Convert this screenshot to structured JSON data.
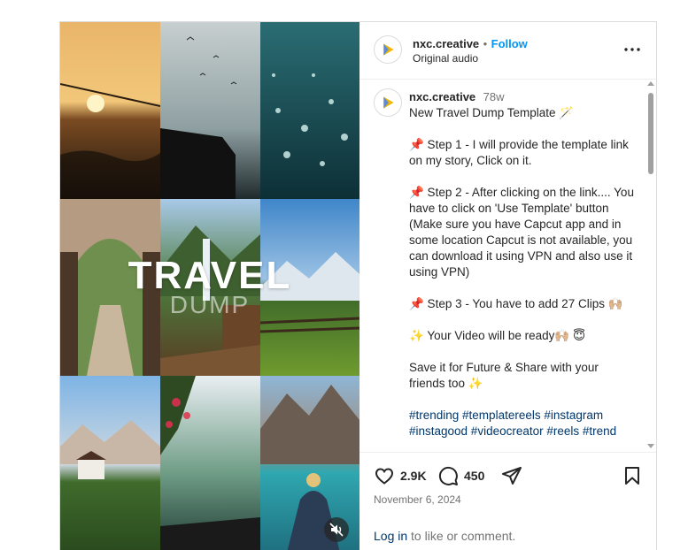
{
  "header": {
    "username": "nxc.creative",
    "separator": "•",
    "follow_label": "Follow",
    "audio_label": "Original audio"
  },
  "caption": {
    "username": "nxc.creative",
    "age": "78w",
    "lines": [
      "New Travel Dump Template 🪄",
      "📌 Step 1 - I will provide the template link on my story, Click on it.",
      "📌 Step 2 - After clicking on the link.... You have to click on 'Use Template' button (Make sure you have Capcut app and in some location Capcut is not available, you can download it using VPN and also use it using VPN)",
      "📌 Step 3 - You have to add 27 Clips 🙌🏼",
      "✨ Your Video will be ready🙌🏼 😇",
      "Save it for Future & Share with your friends too ✨"
    ],
    "hashtags": "#trending #templatereels #instagram #instagood #videocreator #reels #trend"
  },
  "media": {
    "overlay_title": "TRAVEL",
    "overlay_subtitle": "DUMP"
  },
  "actions": {
    "likes": "2.9K",
    "comments": "450",
    "date": "November 6, 2024",
    "login_link": "Log in",
    "login_suffix": " to like or comment."
  },
  "icons": {
    "like": "heart-icon",
    "comment": "comment-bubble-icon",
    "share": "paper-plane-icon",
    "save": "bookmark-icon",
    "more": "more-options-icon",
    "mute": "muted-speaker-icon"
  }
}
